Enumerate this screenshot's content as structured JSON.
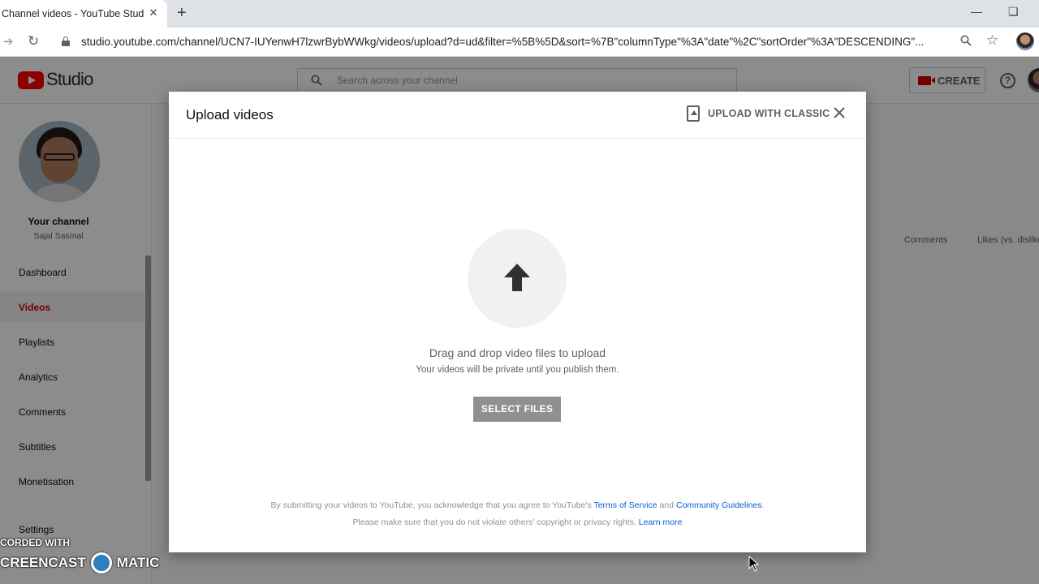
{
  "browser": {
    "tab_title": "Channel videos - YouTube Studio",
    "tab_close": "✕",
    "new_tab": "+",
    "url": "studio.youtube.com/channel/UCN7-IUYenwH7lzwrBybWWkg/videos/upload?d=ud&filter=%5B%5D&sort=%7B\"columnType\"%3A\"date\"%2C\"sortOrder\"%3A\"DESCENDING\"..."
  },
  "header": {
    "logo_text": "Studio",
    "search_placeholder": "Search across your channel",
    "create_label": "CREATE",
    "help_glyph": "?"
  },
  "sidebar": {
    "channel_label": "Your channel",
    "channel_name": "Sajal Sasmal",
    "items": [
      {
        "label": "Dashboard"
      },
      {
        "label": "Videos"
      },
      {
        "label": "Playlists"
      },
      {
        "label": "Analytics"
      },
      {
        "label": "Comments"
      },
      {
        "label": "Subtitles"
      },
      {
        "label": "Monetisation"
      },
      {
        "label": "Settings"
      }
    ]
  },
  "background": {
    "col_comments": "Comments",
    "col_likes": "Likes (vs. dislikes)"
  },
  "dialog": {
    "title": "Upload videos",
    "classic_label": "UPLOAD WITH CLASSIC",
    "drag_text": "Drag and drop video files to upload",
    "private_text": "Your videos will be private until you publish them.",
    "select_label": "SELECT FILES",
    "legal_1_prefix": "By submitting your videos to YouTube, you acknowledge that you agree to YouTube's ",
    "legal_tos": "Terms of Service",
    "legal_and": " and ",
    "legal_guidelines": "Community Guidelines",
    "legal_1_suffix": ".",
    "legal_2_prefix": "Please make sure that you do not violate others' copyright or privacy rights. ",
    "legal_learn": "Learn more"
  },
  "watermark": {
    "line1": "CORDED WITH",
    "line2_left": "CREENCAST",
    "line2_right": "MATIC"
  },
  "colors": {
    "brand_red": "#ff0000",
    "active_red": "#cc0000",
    "link_blue": "#065fd4"
  }
}
